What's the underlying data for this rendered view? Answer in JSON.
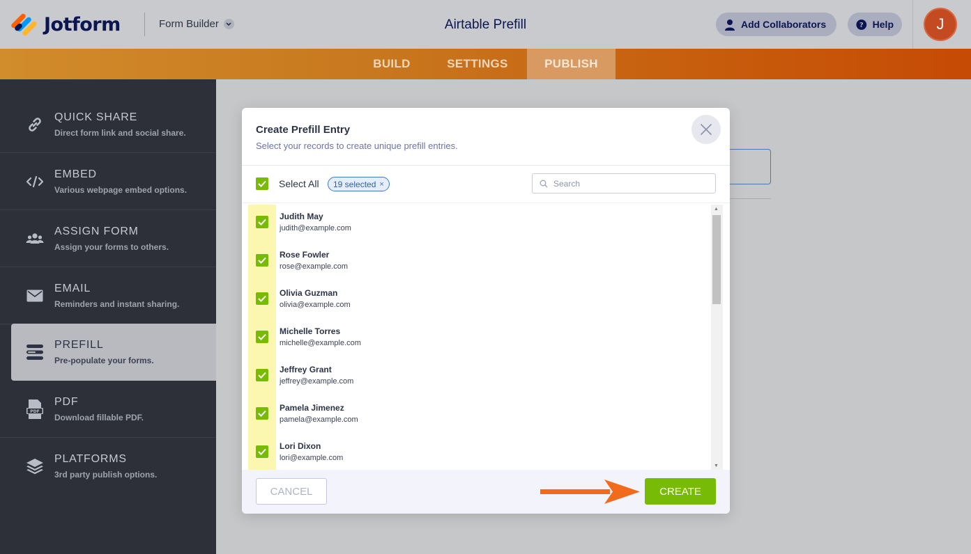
{
  "app": {
    "logo_text": "Jotform",
    "builder_label": "Form Builder",
    "form_title": "Airtable Prefill",
    "add_collaborators": "Add Collaborators",
    "help": "Help",
    "avatar_initial": "J",
    "tabs": [
      {
        "label": "BUILD",
        "active": false
      },
      {
        "label": "SETTINGS",
        "active": false
      },
      {
        "label": "PUBLISH",
        "active": true
      }
    ]
  },
  "sidebar": {
    "items": [
      {
        "title": "QUICK SHARE",
        "desc": "Direct form link and social share.",
        "icon": "link-icon"
      },
      {
        "title": "EMBED",
        "desc": "Various webpage embed options.",
        "icon": "code-icon"
      },
      {
        "title": "ASSIGN FORM",
        "desc": "Assign your forms to others.",
        "icon": "users-icon"
      },
      {
        "title": "EMAIL",
        "desc": "Reminders and instant sharing.",
        "icon": "envelope-icon"
      },
      {
        "title": "PREFILL",
        "desc": "Pre-populate your forms.",
        "icon": "prefill-icon",
        "active": true
      },
      {
        "title": "PDF",
        "desc": "Download fillable PDF.",
        "icon": "pdf-icon",
        "icon_text": "PDF"
      },
      {
        "title": "PLATFORMS",
        "desc": "3rd party publish options.",
        "icon": "layers-icon"
      }
    ]
  },
  "modal": {
    "title": "Create Prefill Entry",
    "subtitle": "Select your records to create unique prefill entries.",
    "select_all": "Select All",
    "selected_badge": "19 selected",
    "badge_close": "×",
    "search_placeholder": "Search",
    "records": [
      {
        "name": "Judith May",
        "email": "judith@example.com",
        "checked": true
      },
      {
        "name": "Rose Fowler",
        "email": "rose@example.com",
        "checked": true
      },
      {
        "name": "Olivia Guzman",
        "email": "olivia@example.com",
        "checked": true
      },
      {
        "name": "Michelle Torres",
        "email": "michelle@example.com",
        "checked": true
      },
      {
        "name": "Jeffrey Grant",
        "email": "jeffrey@example.com",
        "checked": true
      },
      {
        "name": "Pamela Jimenez",
        "email": "pamela@example.com",
        "checked": true
      },
      {
        "name": "Lori Dixon",
        "email": "lori@example.com",
        "checked": true
      }
    ],
    "cancel": "CANCEL",
    "create": "CREATE"
  },
  "colors": {
    "accent_green": "#78bb07",
    "tab_orange": "#c8771e",
    "annotation_arrow": "#f26a1b",
    "sidebar_bg": "#2d3039",
    "avatar": "#c44a21"
  }
}
